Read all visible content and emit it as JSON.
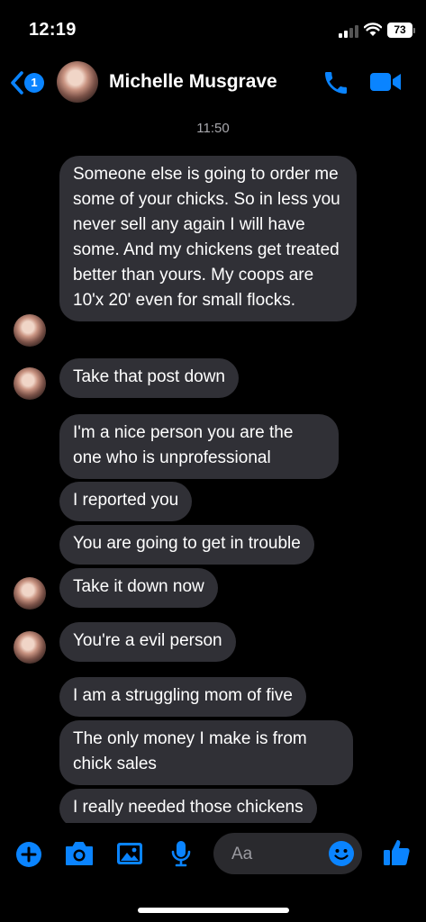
{
  "status_bar": {
    "time": "12:19",
    "battery": "73"
  },
  "header": {
    "back_badge": "1",
    "contact_name": "Michelle Musgrave"
  },
  "conversation": {
    "timestamp": "11:50",
    "messages": [
      "Someone else is going to order me some of your chicks. So in less you never sell any again I will have some. And my chickens get treated better than yours. My coops are 10'x 20' even for small flocks.",
      "Take that post down",
      "I'm a nice person you are the one who is unprofessional",
      "I reported you",
      "You are going to get in trouble",
      "Take it down now",
      "You're a evil person",
      "I am a struggling mom of five",
      "The only money I make is from chick sales",
      "I really needed those chickens"
    ]
  },
  "composer": {
    "placeholder": "Aa"
  },
  "colors": {
    "accent": "#0a84ff",
    "bubble": "#303036",
    "background": "#000000"
  },
  "icons": [
    "back-chevron-icon",
    "phone-icon",
    "video-camera-icon",
    "plus-icon",
    "camera-icon",
    "image-icon",
    "microphone-icon",
    "emoji-icon",
    "thumbs-up-icon"
  ]
}
